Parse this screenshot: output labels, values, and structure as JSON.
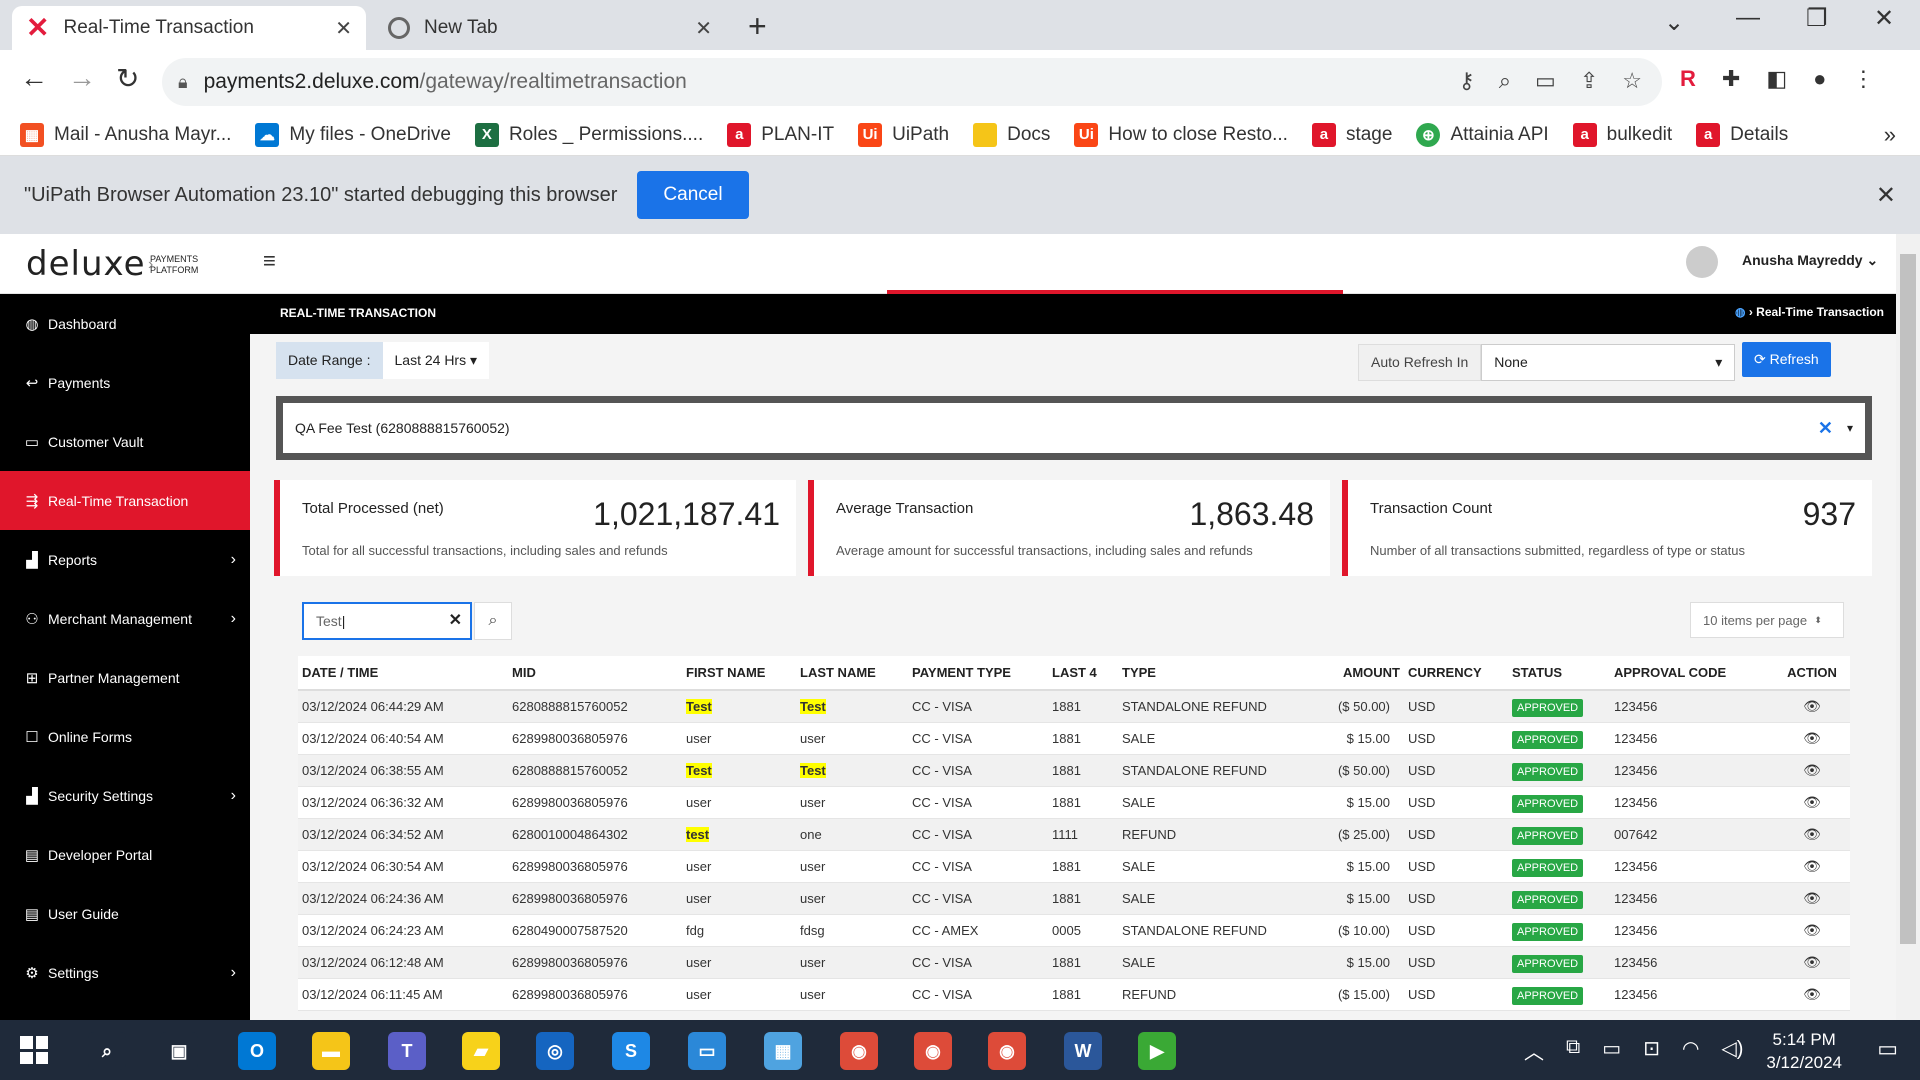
{
  "browser": {
    "tabs": [
      {
        "title": "Real-Time Transaction",
        "close": "✕"
      },
      {
        "title": "New Tab",
        "close": "✕"
      }
    ],
    "new_tab": "+",
    "url_host": "payments2.deluxe.com",
    "url_path": "/gateway/realtimetransaction",
    "bookmarks": [
      {
        "label": "Mail - Anusha Mayr...",
        "color": "#f25022",
        "icon": "windows-icon"
      },
      {
        "label": "My files - OneDrive",
        "color": "#0078d4",
        "icon": "cloud-icon"
      },
      {
        "label": "Roles _ Permissions....",
        "color": "#1d6f42",
        "icon": "excel-icon"
      },
      {
        "label": "PLAN-IT",
        "color": "#e0162b",
        "icon": "a-icon"
      },
      {
        "label": "UiPath",
        "color": "#fa4616",
        "icon": "uipath-icon"
      },
      {
        "label": "Docs",
        "color": "#f5c518",
        "icon": "folder-icon"
      },
      {
        "label": "How to close Resto...",
        "color": "#fa4616",
        "icon": "uipath-icon"
      },
      {
        "label": "stage",
        "color": "#e0162b",
        "icon": "a-icon"
      },
      {
        "label": "Attainia API",
        "color": "#2fa84f",
        "icon": "api-icon"
      },
      {
        "label": "bulkedit",
        "color": "#e0162b",
        "icon": "a-icon"
      },
      {
        "label": "Details",
        "color": "#e0162b",
        "icon": "a-icon"
      }
    ],
    "bookmarks_more": "»"
  },
  "debug_banner": {
    "message": "\"UiPath Browser Automation 23.10\" started debugging this browser",
    "cancel": "Cancel",
    "close": "✕"
  },
  "header": {
    "logo": "deluxe",
    "logo_sub_1": "PAYMENTS",
    "logo_sub_2": "PLATFORM",
    "user": "Anusha Mayreddy"
  },
  "sidebar": {
    "items": [
      {
        "label": "Dashboard",
        "icon": "dashboard-icon",
        "glyph": "◍",
        "chevron": false
      },
      {
        "label": "Payments",
        "icon": "arrow-left-icon",
        "glyph": "↩",
        "chevron": false
      },
      {
        "label": "Customer Vault",
        "icon": "card-icon",
        "glyph": "▭",
        "chevron": false
      },
      {
        "label": "Real-Time Transaction",
        "icon": "pulse-icon",
        "glyph": "⇶",
        "chevron": false,
        "active": true
      },
      {
        "label": "Reports",
        "icon": "bar-chart-icon",
        "glyph": "▟",
        "chevron": true
      },
      {
        "label": "Merchant Management",
        "icon": "user-gear-icon",
        "glyph": "⚇",
        "chevron": true
      },
      {
        "label": "Partner Management",
        "icon": "sitemap-icon",
        "glyph": "⊞",
        "chevron": false
      },
      {
        "label": "Online Forms",
        "icon": "form-icon",
        "glyph": "☐",
        "chevron": false
      },
      {
        "label": "Security Settings",
        "icon": "bar-chart-icon",
        "glyph": "▟",
        "chevron": true
      },
      {
        "label": "Developer Portal",
        "icon": "book-icon",
        "glyph": "▤",
        "chevron": false
      },
      {
        "label": "User Guide",
        "icon": "guide-icon",
        "glyph": "▤",
        "chevron": false
      },
      {
        "label": "Settings",
        "icon": "gear-icon",
        "glyph": "⚙",
        "chevron": true
      }
    ]
  },
  "page": {
    "title": "REAL-TIME TRANSACTION",
    "breadcrumb": "Real-Time Transaction",
    "date_range_label": "Date Range :",
    "date_range_value": "Last 24 Hrs",
    "auto_refresh_label": "Auto Refresh In",
    "auto_refresh_value": "None",
    "refresh_label": "Refresh",
    "merchant": "QA Fee Test (6280888815760052)",
    "search_value": "Test",
    "per_page": "10 items per page"
  },
  "cards": [
    {
      "title": "Total Processed (net)",
      "value": "1,021,187.41",
      "desc": "Total for all successful transactions, including sales and refunds"
    },
    {
      "title": "Average Transaction",
      "value": "1,863.48",
      "desc": "Average amount for successful transactions, including sales and refunds"
    },
    {
      "title": "Transaction Count",
      "value": "937",
      "desc": "Number of all transactions submitted, regardless of type or status"
    }
  ],
  "table": {
    "headers": [
      "DATE / TIME",
      "MID",
      "FIRST NAME",
      "LAST NAME",
      "PAYMENT TYPE",
      "LAST 4",
      "TYPE",
      "AMOUNT",
      "CURRENCY",
      "STATUS",
      "APPROVAL CODE",
      "ACTION"
    ],
    "rows": [
      {
        "date": "03/12/2024 06:44:29 AM",
        "mid": "6280888815760052",
        "first": "Test",
        "last": "Test",
        "ptype": "CC - VISA",
        "last4": "1881",
        "type": "STANDALONE REFUND",
        "amount": "($ 50.00)",
        "currency": "USD",
        "status": "APPROVED",
        "code": "123456",
        "hl_first": true,
        "hl_last": true
      },
      {
        "date": "03/12/2024 06:40:54 AM",
        "mid": "6289980036805976",
        "first": "user",
        "last": "user",
        "ptype": "CC - VISA",
        "last4": "1881",
        "type": "SALE",
        "amount": "$ 15.00",
        "currency": "USD",
        "status": "APPROVED",
        "code": "123456",
        "hl_first": false,
        "hl_last": false
      },
      {
        "date": "03/12/2024 06:38:55 AM",
        "mid": "6280888815760052",
        "first": "Test",
        "last": "Test",
        "ptype": "CC - VISA",
        "last4": "1881",
        "type": "STANDALONE REFUND",
        "amount": "($ 50.00)",
        "currency": "USD",
        "status": "APPROVED",
        "code": "123456",
        "hl_first": true,
        "hl_last": true
      },
      {
        "date": "03/12/2024 06:36:32 AM",
        "mid": "6289980036805976",
        "first": "user",
        "last": "user",
        "ptype": "CC - VISA",
        "last4": "1881",
        "type": "SALE",
        "amount": "$ 15.00",
        "currency": "USD",
        "status": "APPROVED",
        "code": "123456",
        "hl_first": false,
        "hl_last": false
      },
      {
        "date": "03/12/2024 06:34:52 AM",
        "mid": "6280010004864302",
        "first": "test",
        "last": "one",
        "ptype": "CC - VISA",
        "last4": "1111",
        "type": "REFUND",
        "amount": "($ 25.00)",
        "currency": "USD",
        "status": "APPROVED",
        "code": "007642",
        "hl_first": true,
        "hl_last": false
      },
      {
        "date": "03/12/2024 06:30:54 AM",
        "mid": "6289980036805976",
        "first": "user",
        "last": "user",
        "ptype": "CC - VISA",
        "last4": "1881",
        "type": "SALE",
        "amount": "$ 15.00",
        "currency": "USD",
        "status": "APPROVED",
        "code": "123456",
        "hl_first": false,
        "hl_last": false
      },
      {
        "date": "03/12/2024 06:24:36 AM",
        "mid": "6289980036805976",
        "first": "user",
        "last": "user",
        "ptype": "CC - VISA",
        "last4": "1881",
        "type": "SALE",
        "amount": "$ 15.00",
        "currency": "USD",
        "status": "APPROVED",
        "code": "123456",
        "hl_first": false,
        "hl_last": false
      },
      {
        "date": "03/12/2024 06:24:23 AM",
        "mid": "6280490007587520",
        "first": "fdg",
        "last": "fdsg",
        "ptype": "CC - AMEX",
        "last4": "0005",
        "type": "STANDALONE REFUND",
        "amount": "($ 10.00)",
        "currency": "USD",
        "status": "APPROVED",
        "code": "123456",
        "hl_first": false,
        "hl_last": false
      },
      {
        "date": "03/12/2024 06:12:48 AM",
        "mid": "6289980036805976",
        "first": "user",
        "last": "user",
        "ptype": "CC - VISA",
        "last4": "1881",
        "type": "SALE",
        "amount": "$ 15.00",
        "currency": "USD",
        "status": "APPROVED",
        "code": "123456",
        "hl_first": false,
        "hl_last": false
      },
      {
        "date": "03/12/2024 06:11:45 AM",
        "mid": "6289980036805976",
        "first": "user",
        "last": "user",
        "ptype": "CC - VISA",
        "last4": "1881",
        "type": "REFUND",
        "amount": "($ 15.00)",
        "currency": "USD",
        "status": "APPROVED",
        "code": "123456",
        "hl_first": false,
        "hl_last": false
      }
    ]
  },
  "taskbar": {
    "time": "5:14 PM",
    "date": "3/12/2024",
    "apps": [
      {
        "icon": "search-icon",
        "color": "#1f2a3a",
        "glyph": "⌕"
      },
      {
        "icon": "task-view-icon",
        "color": "#1f2a3a",
        "glyph": "▣"
      },
      {
        "icon": "outlook-icon",
        "color": "#0078d4",
        "glyph": "O"
      },
      {
        "icon": "file-explorer-icon",
        "color": "#f5c518",
        "glyph": "▬"
      },
      {
        "icon": "teams-icon",
        "color": "#5b5fc7",
        "glyph": "T"
      },
      {
        "icon": "sticky-notes-icon",
        "color": "#f7d21a",
        "glyph": "▰"
      },
      {
        "icon": "app-swirl-icon",
        "color": "#1565c0",
        "glyph": "◎"
      },
      {
        "icon": "app-s-icon",
        "color": "#1e88e5",
        "glyph": "S"
      },
      {
        "icon": "monitor-icon",
        "color": "#2b88d8",
        "glyph": "▭"
      },
      {
        "icon": "control-panel-icon",
        "color": "#4fa3e0",
        "glyph": "▦"
      },
      {
        "icon": "chrome-icon",
        "color": "#dd4b39",
        "glyph": "◉"
      },
      {
        "icon": "chrome-icon",
        "color": "#dd4b39",
        "glyph": "◉"
      },
      {
        "icon": "chrome-icon",
        "color": "#dd4b39",
        "glyph": "◉"
      },
      {
        "icon": "word-icon",
        "color": "#2b579a",
        "glyph": "W"
      },
      {
        "icon": "media-player-icon",
        "color": "#3aa935",
        "glyph": "▶"
      }
    ]
  }
}
